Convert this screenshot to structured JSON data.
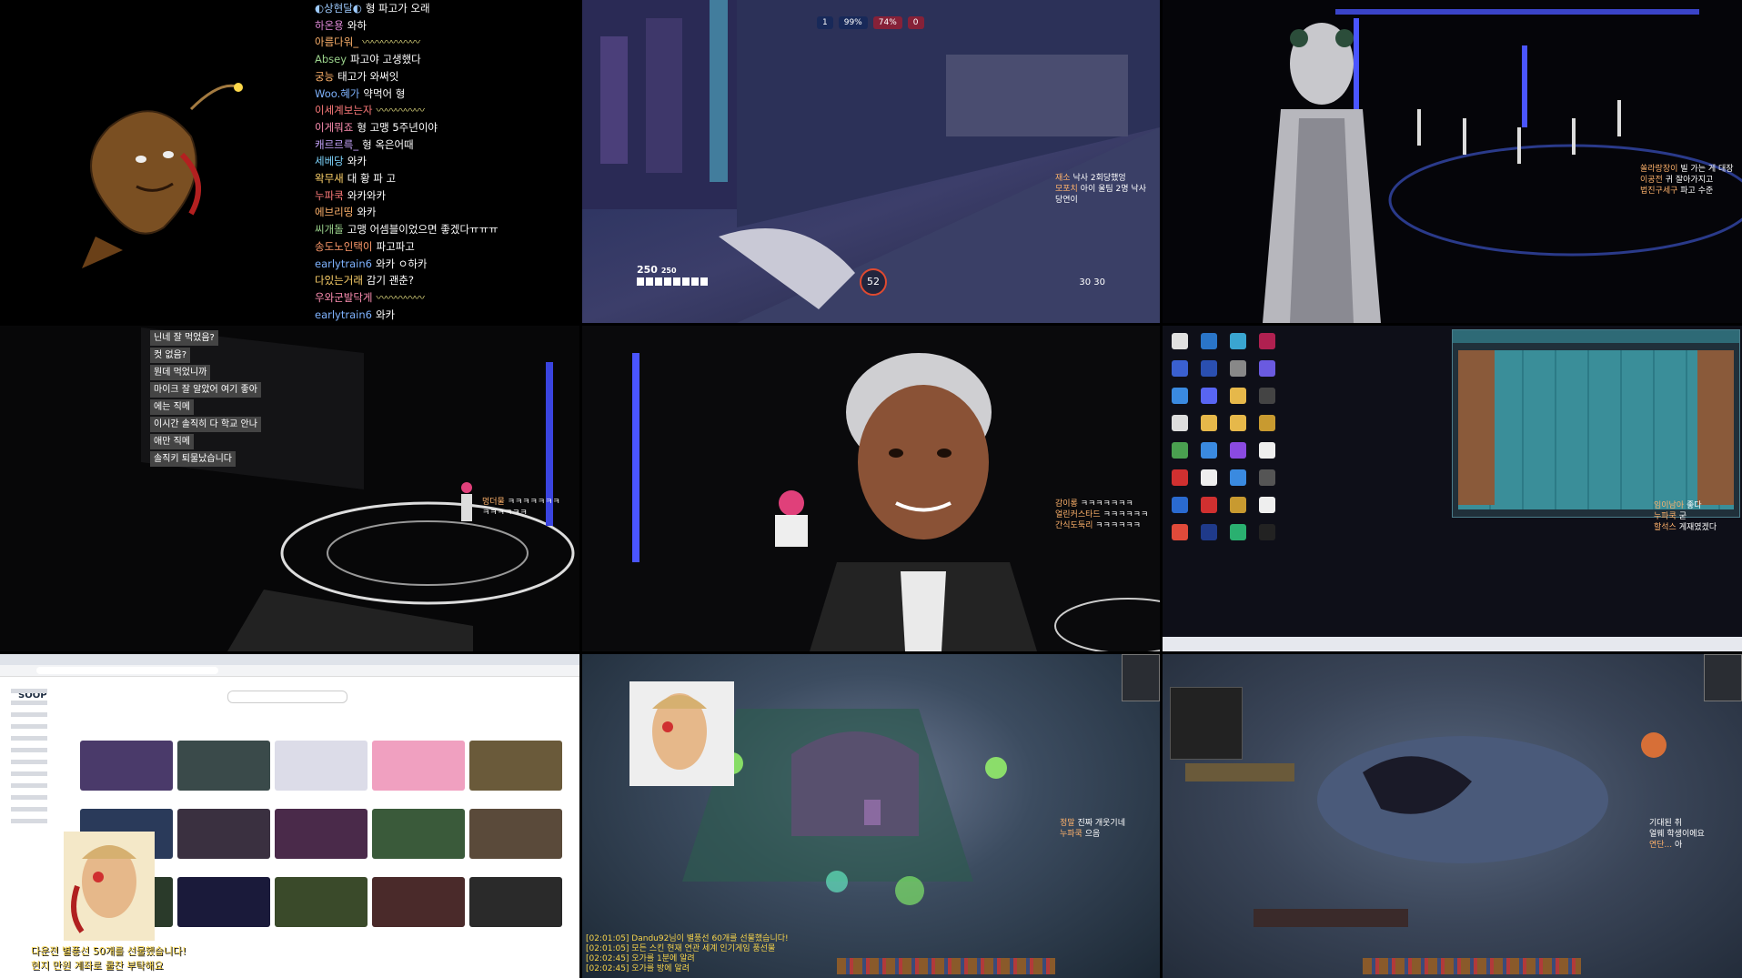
{
  "tile1": {
    "chat": [
      {
        "nick": "◐상현달◐",
        "msg": "형 파고가 오래",
        "color": "#9ecbff"
      },
      {
        "nick": "하온용",
        "msg": "와하",
        "color": "#e08ad8"
      },
      {
        "nick": "아름다워_",
        "msg": "",
        "emote": "〰〰〰〰〰〰",
        "color": "#ffb26b"
      },
      {
        "nick": "Absey",
        "msg": "파고야 고생했다",
        "color": "#9ad18b"
      },
      {
        "nick": "궁능",
        "msg": "태고가 와써잇",
        "color": "#ffb26b"
      },
      {
        "nick": "Woo.혜가",
        "msg": "약먹어 형",
        "color": "#7fb3ff"
      },
      {
        "nick": "이세계보는자",
        "msg": "",
        "emote": "〰〰〰〰〰",
        "color": "#ff7b7b"
      },
      {
        "nick": "이게뭐죠",
        "msg": "형 고맹 5주년이야",
        "color": "#ff8fb3"
      },
      {
        "nick": "캐르르륵_",
        "msg": "형 옥은어때",
        "color": "#c9a6ff"
      },
      {
        "nick": "세베당",
        "msg": "와카",
        "color": "#7fd6ff"
      },
      {
        "nick": "왁무새",
        "msg": "대 황 파 고",
        "color": "#ffd36b"
      },
      {
        "nick": "누파쿡",
        "msg": "와카와카",
        "color": "#ff7b7b"
      },
      {
        "nick": "에브리띵",
        "msg": "와카",
        "color": "#ffb26b"
      },
      {
        "nick": "씨개돌",
        "msg": "고맹 어셈블이었으면 좋겠다ㅠㅠㅠ",
        "color": "#9ad18b"
      },
      {
        "nick": "송도노인택이",
        "msg": "파고파고",
        "color": "#ff9a6b"
      },
      {
        "nick": "earlytrain6",
        "msg": "와카 ㅇ하카",
        "color": "#7fb3ff"
      },
      {
        "nick": "다있는거래",
        "msg": "감기 괜춘?",
        "color": "#ffd36b"
      },
      {
        "nick": "우와군발닥게",
        "msg": "",
        "emote": "〰〰〰〰〰",
        "color": "#ff8fb3"
      },
      {
        "nick": "earlytrain6",
        "msg": "와카",
        "color": "#7fb3ff"
      }
    ]
  },
  "tile2": {
    "score_left": "1",
    "score_pct_left": "99%",
    "score_pct_right": "74%",
    "score_right": "0",
    "health": "250",
    "health_max": "250",
    "ammo": "30",
    "ammo_max": "30",
    "timer": "52",
    "chat": [
      {
        "nick": "재소",
        "msg": "낙사 2회당했엉"
      },
      {
        "nick": "모포치",
        "msg": "아이 울팀 2명 낙사"
      },
      {
        "nick": "",
        "msg": "당연이"
      }
    ]
  },
  "tile3": {
    "chat": [
      {
        "nick": "쏠라랑장이",
        "msg": "빌 가는 게 대장"
      },
      {
        "nick": "이공전",
        "msg": "귀 잘아가지고"
      },
      {
        "nick": "법진구세구",
        "msg": "파고 수준"
      }
    ]
  },
  "tile4": {
    "wall_text": [
      "닌네 잘 먹었음?",
      "컷 없음?",
      "뭔데 먹었니까",
      "마이크 잘 알았어 여기 좋아",
      "에는 직메",
      "이시간 솔직히 다 학교 안나",
      "애만 직메",
      "솔직키 퇴물났습니다"
    ],
    "chat": [
      {
        "nick": "멍더물",
        "msg": "ㅋㅋㅋㅋㅋㅋㅋ"
      },
      {
        "nick": "",
        "msg": "ㅋㅋㅋㅋㅋㅋ"
      }
    ]
  },
  "tile5": {
    "chat": [
      {
        "nick": "감이롱",
        "msg": "ㅋㅋㅋㅋㅋㅋㅋ"
      },
      {
        "nick": "얼린커스타드",
        "msg": "ㅋㅋㅋㅋㅋㅋ"
      },
      {
        "nick": "간식도둑리",
        "msg": "ㅋㅋㅋㅋㅋㅋ"
      }
    ]
  },
  "tile6": {
    "chat": [
      {
        "nick": "임이남아",
        "msg": "좋다"
      },
      {
        "nick": "누파쿡",
        "msg": "굳"
      },
      {
        "nick": "할석스",
        "msg": "게재였겠다"
      }
    ]
  },
  "tile7": {
    "logo": "SOOP",
    "overlay_line1": "다운전 별풍선 50개를 선물했습니다!",
    "overlay_line2": "현지 만원 계좌로 쿨찬 부탁해요"
  },
  "tile8": {
    "system": [
      "[02:01:05] Dandu92님이 별풍선 60개를 선물했습니다!",
      "[02:01:05] 모든 스킨 현재 연관 세계 인기게임 풍선물",
      "[02:02:45] 오가를 1분에 알려",
      "[02:02:45] 오가를 방에 알려"
    ],
    "chat": [
      {
        "nick": "정말",
        "msg": "진짜 개웃기네"
      },
      {
        "nick": "누파쿡",
        "msg": "으음"
      }
    ]
  },
  "tile9": {
    "chat": [
      {
        "nick": "",
        "msg": "기대된 취"
      },
      {
        "nick": "",
        "msg": "얼웨 학생이에요"
      },
      {
        "nick": "연단...",
        "msg": "아"
      }
    ]
  }
}
